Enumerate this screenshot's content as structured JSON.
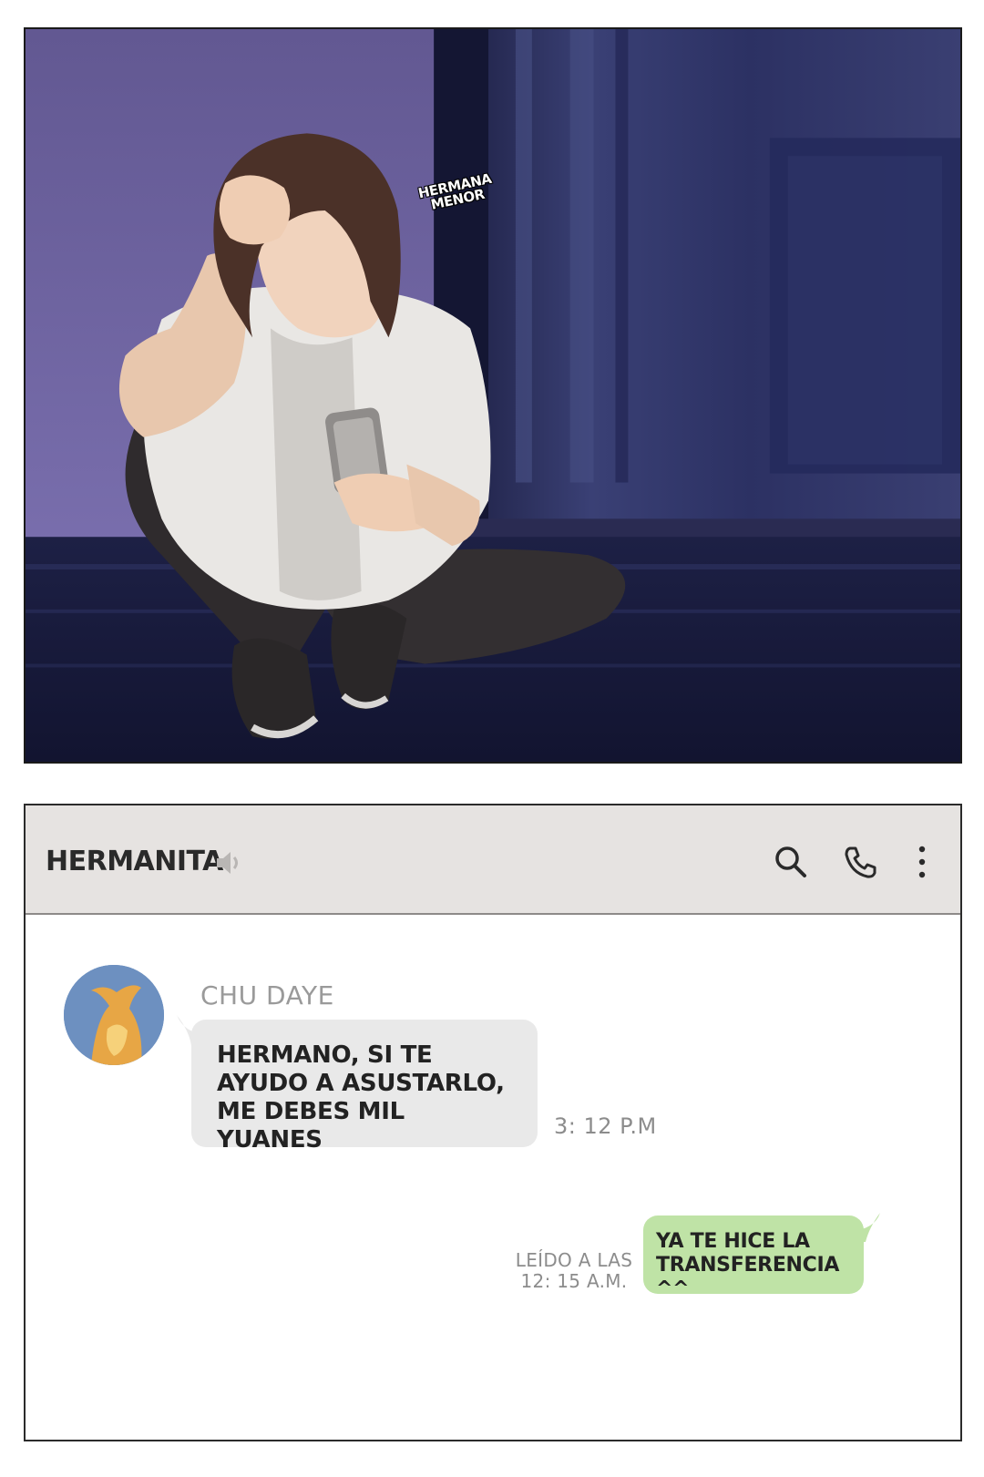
{
  "illustration": {
    "sfx_text": "HERMANA\nMENOR"
  },
  "chat": {
    "title": "HERMANITA",
    "icons": [
      "speaker-icon",
      "search-icon",
      "phone-icon",
      "more-icon"
    ],
    "messages": [
      {
        "direction": "incoming",
        "sender": "CHU DAYE",
        "text": "HERMANO, SI TE AYUDO A ASUSTARLO, ME DEBES MIL YUANES",
        "time": "3: 12 P.M"
      },
      {
        "direction": "outgoing",
        "text": "YA TE HICE LA TRANSFERENCIA ^^",
        "receipt": "LEÍDO A LAS 12: 15 A.M."
      }
    ]
  },
  "colors": {
    "header_bg": "#e6e3e1",
    "incoming_bubble": "#e9e9e9",
    "outgoing_bubble": "#bfe3a6",
    "room_wall": "#6e649e",
    "room_dark": "#1f2143"
  }
}
